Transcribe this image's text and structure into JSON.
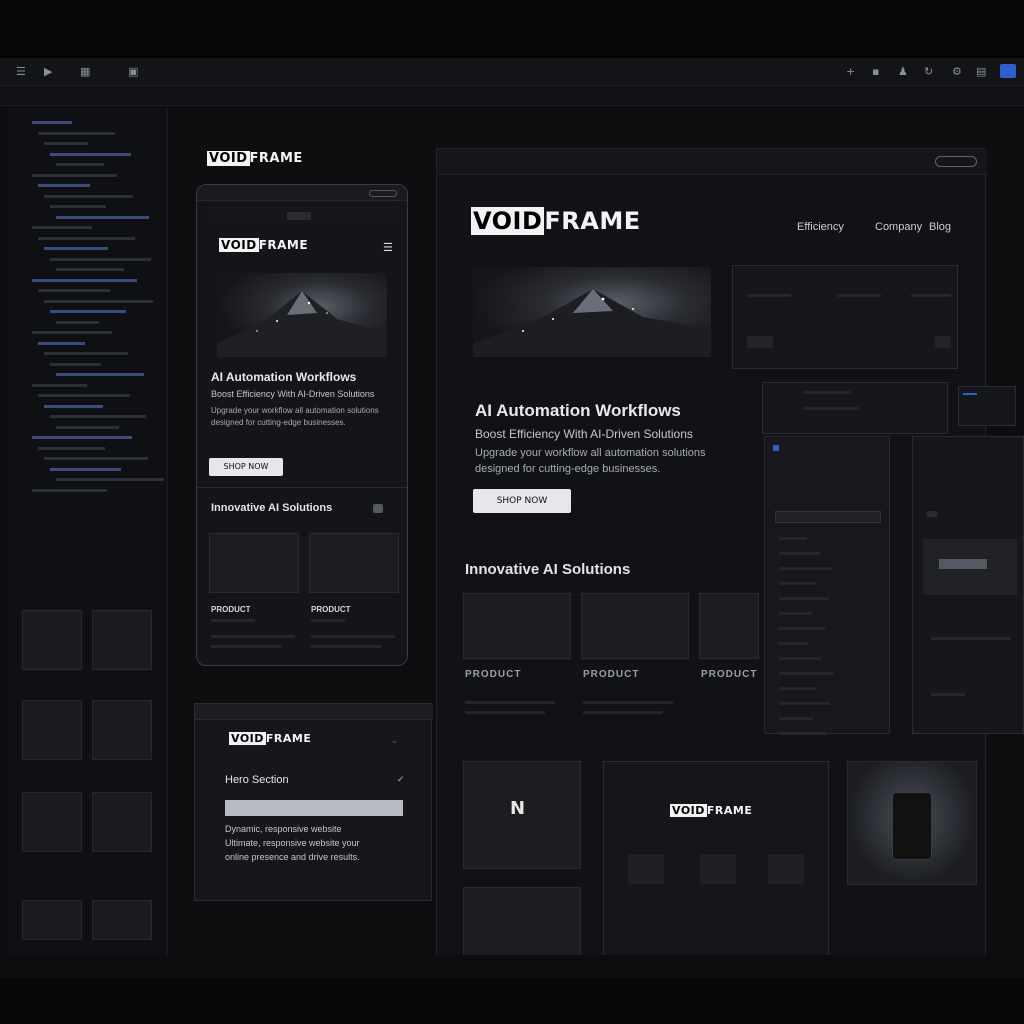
{
  "brand": {
    "logo_left": "VOID",
    "logo_right": "FRAME"
  },
  "mobile": {
    "heading": "AI Automation Workflows",
    "subheading": "Boost Efficiency With AI-Driven Solutions",
    "body": "Upgrade your workflow all automation solutions designed for cutting-edge businesses.",
    "cta": "SHOP NOW",
    "section_title": "Innovative AI Solutions",
    "product_a": "PRODUCT",
    "product_b": "PRODUCT"
  },
  "desktop": {
    "nav": [
      "Efficiency",
      "Company",
      "Blog"
    ],
    "heading": "AI Automation Workflows",
    "subheading": "Boost Efficiency With AI-Driven Solutions",
    "body_line1": "Upgrade your workflow all automation solutions",
    "body_line2": "designed for cutting-edge businesses.",
    "cta": "SHOP NOW",
    "section_title": "Innovative AI Solutions",
    "products": [
      "PRODUCT",
      "PRODUCT",
      "PRODUCT"
    ]
  },
  "editor_panel": {
    "section_label": "Hero Section",
    "desc_line1": "Dynamic, responsive website",
    "desc_line2": "Ultimate, responsive website your",
    "desc_line3": "online presence and drive results."
  },
  "colors": {
    "background": "#060607",
    "panel": "#141518",
    "accent": "#2f5fd0",
    "text": "#cfd2d8"
  },
  "icons": [
    "hamburger-icon",
    "play-icon",
    "grid-icon",
    "plus-icon",
    "user-icon",
    "chevron-down-icon",
    "menu-icon"
  ]
}
